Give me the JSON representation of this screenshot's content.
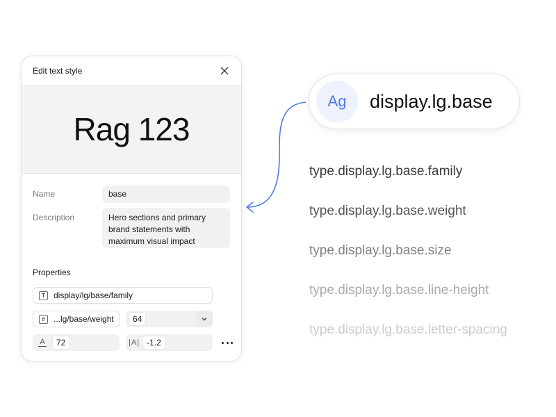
{
  "dialog": {
    "title": "Edit text style",
    "preview_text": "Rag 123",
    "name_label": "Name",
    "name_value": "base",
    "description_label": "Description",
    "description_value": "Hero sections and primary brand statements with maximum visual impact",
    "properties_label": "Properties",
    "family_value": "display/lg/base/family",
    "weight_token": "...lg/base/weight",
    "weight_value": "64",
    "size_value": "72",
    "letter_spacing_value": "-1.2"
  },
  "style_pill": {
    "icon_text": "Ag",
    "label": "display.lg.base"
  },
  "tokens": [
    "type.display.lg.base.family",
    "type.display.lg.base.weight",
    "type.display.lg.base.size",
    "type.display.lg.base.line-height",
    "type.display.lg.base.letter-spacing"
  ],
  "colors": {
    "accent": "#4b7be5",
    "token_shades": [
      "#3a3a3a",
      "#555555",
      "#828282",
      "#ababab",
      "#cccccc"
    ]
  }
}
